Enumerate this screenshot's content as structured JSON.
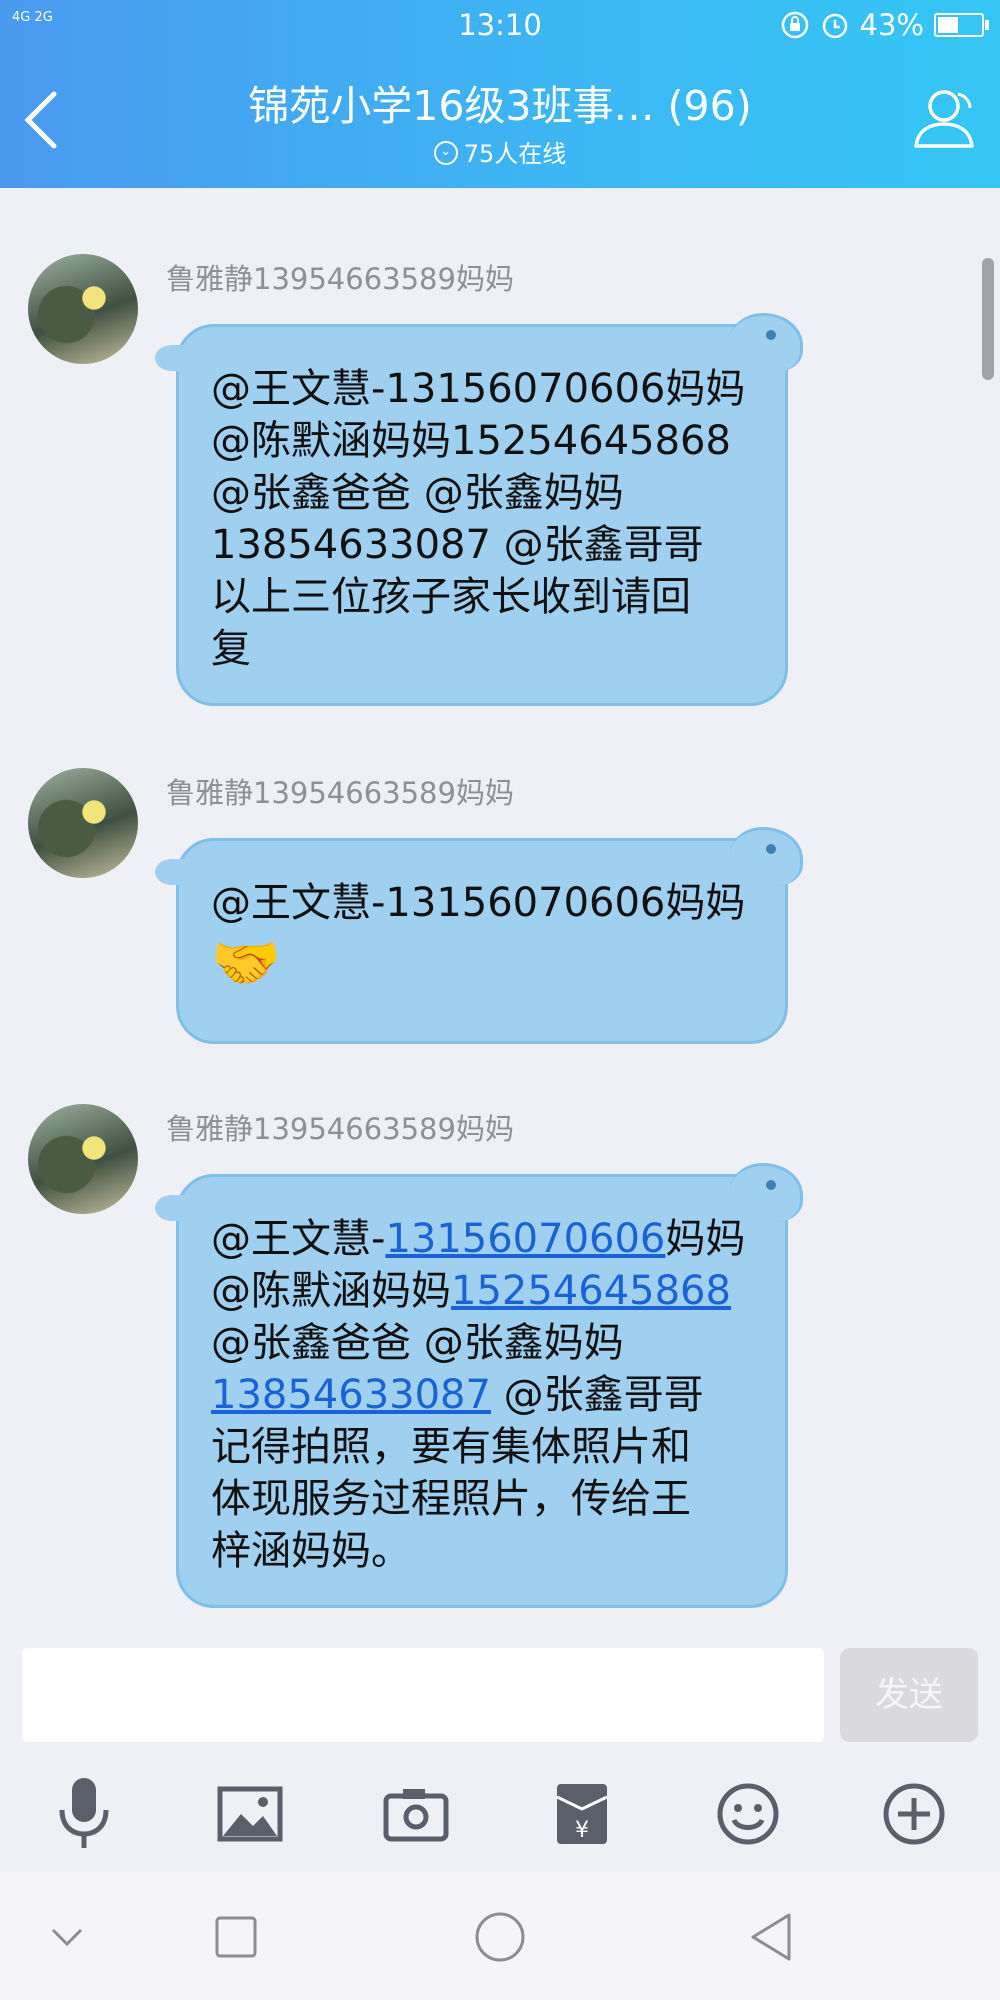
{
  "status_bar": {
    "network": "4G 2G",
    "time": "13:10",
    "battery": "43%",
    "battery_level": 0.43
  },
  "header": {
    "title": "锦苑小学16级3班事… (96)",
    "online": "75人在线"
  },
  "messages": [
    {
      "sender": "鲁雅静13954663589妈妈",
      "text": "@王文慧-13156070606妈妈\n@陈默涵妈妈15254645868\n@张鑫爸爸 @张鑫妈妈\n13854633087 @张鑫哥哥\n以上三位孩子家长收到请回\n复"
    },
    {
      "sender": "鲁雅静13954663589妈妈",
      "text": "@王文慧-13156070606妈妈",
      "emoji": "🤝"
    },
    {
      "sender": "鲁雅静13954663589妈妈",
      "line1_prefix": "@王文慧-",
      "line1_link": "13156070606",
      "line1_suffix": "妈妈",
      "line2_prefix": "@陈默涵妈妈",
      "line2_link": "15254645868",
      "line3": "@张鑫爸爸 @张鑫妈妈",
      "line4_link": "13854633087",
      "line4_suffix": " @张鑫哥哥",
      "rest": "记得拍照，要有集体照片和\n体现服务过程照片，传给王\n梓涵妈妈。"
    }
  ],
  "composer": {
    "input_value": "",
    "send_label": "发送"
  },
  "toolbar": [
    "microphone-icon",
    "image-icon",
    "camera-icon",
    "red-packet-icon",
    "emoji-icon",
    "plus-icon"
  ],
  "navbar": [
    "chevron-down-icon",
    "recent-apps-icon",
    "home-icon",
    "back-triangle-icon"
  ]
}
